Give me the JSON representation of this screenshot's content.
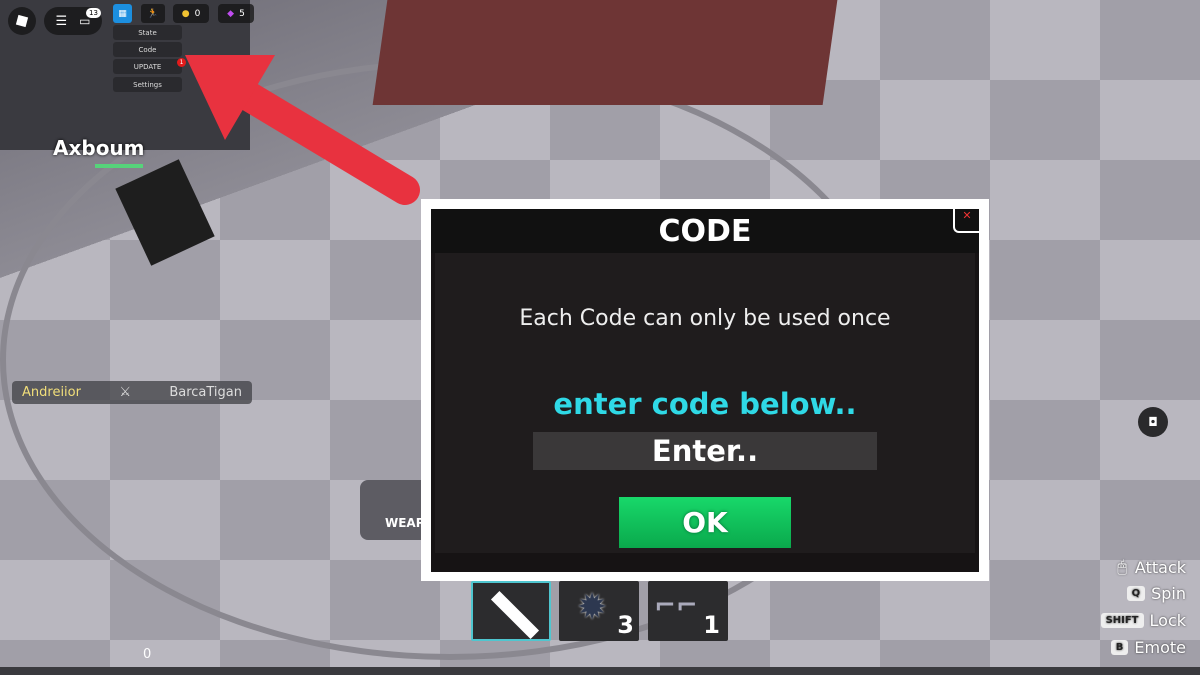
{
  "topbar": {
    "chat_badge": "13",
    "coins": "0",
    "gems": "5"
  },
  "menu": {
    "items": [
      "State",
      "Code",
      "UPDATE",
      "Settings"
    ],
    "update_badge": "1"
  },
  "player": {
    "name": "Axboum"
  },
  "match": {
    "left": "Andreiior",
    "right": "BarcaTigan"
  },
  "weapons_label": "WEAP",
  "dialog": {
    "title": "CODE",
    "message": "Each Code can only be used once",
    "prompt": "enter code below..",
    "input_placeholder": "Enter..",
    "ok_label": "OK"
  },
  "hotbar": [
    {
      "icon": "sword-icon",
      "count": ""
    },
    {
      "icon": "spiked-ball-icon",
      "count": "3"
    },
    {
      "icon": "dual-pistols-icon",
      "count": "1"
    }
  ],
  "controls": [
    {
      "key": "mouse",
      "label": "Attack"
    },
    {
      "key": "Q",
      "label": "Spin"
    },
    {
      "key": "SHIFT",
      "label": "Lock"
    },
    {
      "key": "B",
      "label": "Emote"
    }
  ],
  "bottom_counter": "0",
  "colors": {
    "accent_cyan": "#2fd9e6",
    "ok_green": "#10c75a",
    "arrow_red": "#e8323f"
  }
}
